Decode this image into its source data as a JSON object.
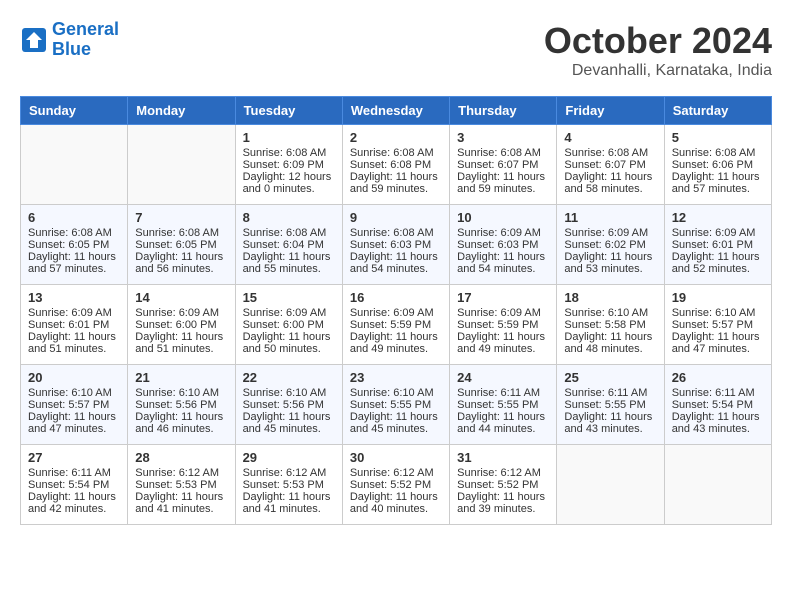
{
  "header": {
    "logo_line1": "General",
    "logo_line2": "Blue",
    "month": "October 2024",
    "location": "Devanhalli, Karnataka, India"
  },
  "days_of_week": [
    "Sunday",
    "Monday",
    "Tuesday",
    "Wednesday",
    "Thursday",
    "Friday",
    "Saturday"
  ],
  "weeks": [
    [
      {
        "day": "",
        "info": ""
      },
      {
        "day": "",
        "info": ""
      },
      {
        "day": "1",
        "info": "Sunrise: 6:08 AM\nSunset: 6:09 PM\nDaylight: 12 hours\nand 0 minutes."
      },
      {
        "day": "2",
        "info": "Sunrise: 6:08 AM\nSunset: 6:08 PM\nDaylight: 11 hours\nand 59 minutes."
      },
      {
        "day": "3",
        "info": "Sunrise: 6:08 AM\nSunset: 6:07 PM\nDaylight: 11 hours\nand 59 minutes."
      },
      {
        "day": "4",
        "info": "Sunrise: 6:08 AM\nSunset: 6:07 PM\nDaylight: 11 hours\nand 58 minutes."
      },
      {
        "day": "5",
        "info": "Sunrise: 6:08 AM\nSunset: 6:06 PM\nDaylight: 11 hours\nand 57 minutes."
      }
    ],
    [
      {
        "day": "6",
        "info": "Sunrise: 6:08 AM\nSunset: 6:05 PM\nDaylight: 11 hours\nand 57 minutes."
      },
      {
        "day": "7",
        "info": "Sunrise: 6:08 AM\nSunset: 6:05 PM\nDaylight: 11 hours\nand 56 minutes."
      },
      {
        "day": "8",
        "info": "Sunrise: 6:08 AM\nSunset: 6:04 PM\nDaylight: 11 hours\nand 55 minutes."
      },
      {
        "day": "9",
        "info": "Sunrise: 6:08 AM\nSunset: 6:03 PM\nDaylight: 11 hours\nand 54 minutes."
      },
      {
        "day": "10",
        "info": "Sunrise: 6:09 AM\nSunset: 6:03 PM\nDaylight: 11 hours\nand 54 minutes."
      },
      {
        "day": "11",
        "info": "Sunrise: 6:09 AM\nSunset: 6:02 PM\nDaylight: 11 hours\nand 53 minutes."
      },
      {
        "day": "12",
        "info": "Sunrise: 6:09 AM\nSunset: 6:01 PM\nDaylight: 11 hours\nand 52 minutes."
      }
    ],
    [
      {
        "day": "13",
        "info": "Sunrise: 6:09 AM\nSunset: 6:01 PM\nDaylight: 11 hours\nand 51 minutes."
      },
      {
        "day": "14",
        "info": "Sunrise: 6:09 AM\nSunset: 6:00 PM\nDaylight: 11 hours\nand 51 minutes."
      },
      {
        "day": "15",
        "info": "Sunrise: 6:09 AM\nSunset: 6:00 PM\nDaylight: 11 hours\nand 50 minutes."
      },
      {
        "day": "16",
        "info": "Sunrise: 6:09 AM\nSunset: 5:59 PM\nDaylight: 11 hours\nand 49 minutes."
      },
      {
        "day": "17",
        "info": "Sunrise: 6:09 AM\nSunset: 5:59 PM\nDaylight: 11 hours\nand 49 minutes."
      },
      {
        "day": "18",
        "info": "Sunrise: 6:10 AM\nSunset: 5:58 PM\nDaylight: 11 hours\nand 48 minutes."
      },
      {
        "day": "19",
        "info": "Sunrise: 6:10 AM\nSunset: 5:57 PM\nDaylight: 11 hours\nand 47 minutes."
      }
    ],
    [
      {
        "day": "20",
        "info": "Sunrise: 6:10 AM\nSunset: 5:57 PM\nDaylight: 11 hours\nand 47 minutes."
      },
      {
        "day": "21",
        "info": "Sunrise: 6:10 AM\nSunset: 5:56 PM\nDaylight: 11 hours\nand 46 minutes."
      },
      {
        "day": "22",
        "info": "Sunrise: 6:10 AM\nSunset: 5:56 PM\nDaylight: 11 hours\nand 45 minutes."
      },
      {
        "day": "23",
        "info": "Sunrise: 6:10 AM\nSunset: 5:55 PM\nDaylight: 11 hours\nand 45 minutes."
      },
      {
        "day": "24",
        "info": "Sunrise: 6:11 AM\nSunset: 5:55 PM\nDaylight: 11 hours\nand 44 minutes."
      },
      {
        "day": "25",
        "info": "Sunrise: 6:11 AM\nSunset: 5:55 PM\nDaylight: 11 hours\nand 43 minutes."
      },
      {
        "day": "26",
        "info": "Sunrise: 6:11 AM\nSunset: 5:54 PM\nDaylight: 11 hours\nand 43 minutes."
      }
    ],
    [
      {
        "day": "27",
        "info": "Sunrise: 6:11 AM\nSunset: 5:54 PM\nDaylight: 11 hours\nand 42 minutes."
      },
      {
        "day": "28",
        "info": "Sunrise: 6:12 AM\nSunset: 5:53 PM\nDaylight: 11 hours\nand 41 minutes."
      },
      {
        "day": "29",
        "info": "Sunrise: 6:12 AM\nSunset: 5:53 PM\nDaylight: 11 hours\nand 41 minutes."
      },
      {
        "day": "30",
        "info": "Sunrise: 6:12 AM\nSunset: 5:52 PM\nDaylight: 11 hours\nand 40 minutes."
      },
      {
        "day": "31",
        "info": "Sunrise: 6:12 AM\nSunset: 5:52 PM\nDaylight: 11 hours\nand 39 minutes."
      },
      {
        "day": "",
        "info": ""
      },
      {
        "day": "",
        "info": ""
      }
    ]
  ]
}
